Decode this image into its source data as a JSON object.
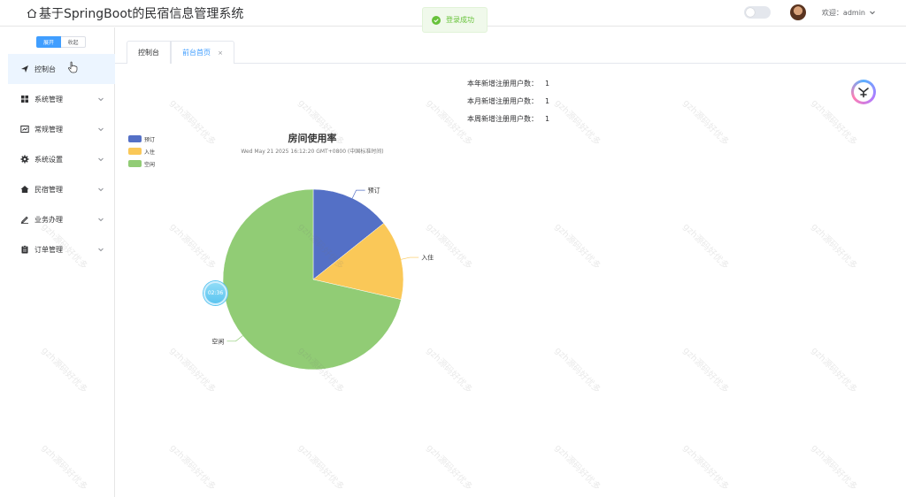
{
  "header": {
    "title": "基于SpringBoot的民宿信息管理系统",
    "welcome": "欢迎：admin"
  },
  "toast": {
    "message": "登录成功"
  },
  "sidebar": {
    "expand_label": "展开",
    "collapse_label": "收起",
    "items": [
      {
        "label": "控制台",
        "icon": "send-icon",
        "active": true
      },
      {
        "label": "系统管理",
        "icon": "grid-icon"
      },
      {
        "label": "常规管理",
        "icon": "dashboard-icon"
      },
      {
        "label": "系统设置",
        "icon": "gear-icon"
      },
      {
        "label": "民宿管理",
        "icon": "home-icon"
      },
      {
        "label": "业务办理",
        "icon": "edit-icon"
      },
      {
        "label": "订单管理",
        "icon": "clipboard-icon"
      }
    ]
  },
  "tabs": [
    {
      "label": "控制台"
    },
    {
      "label": "前台首页",
      "active": true,
      "close": "×"
    }
  ],
  "stats": [
    {
      "label": "本年新增注册用户数：",
      "value": "1"
    },
    {
      "label": "本月新增注册用户数：",
      "value": "1"
    },
    {
      "label": "本周新增注册用户数：",
      "value": "1"
    }
  ],
  "timer": "02:36",
  "watermark_text": "gzh源码好优多",
  "chart_data": {
    "type": "pie",
    "title": "房间使用率",
    "subtitle": "Wed May 21 2025 16:12:20 GMT+0800 (中国标准时间)",
    "legend_position": "top-left",
    "series": [
      {
        "name": "预订",
        "value": 1,
        "color": "#5470c6"
      },
      {
        "name": "入住",
        "value": 1,
        "color": "#fac858"
      },
      {
        "name": "空闲",
        "value": 5,
        "color": "#91cc75"
      }
    ]
  }
}
